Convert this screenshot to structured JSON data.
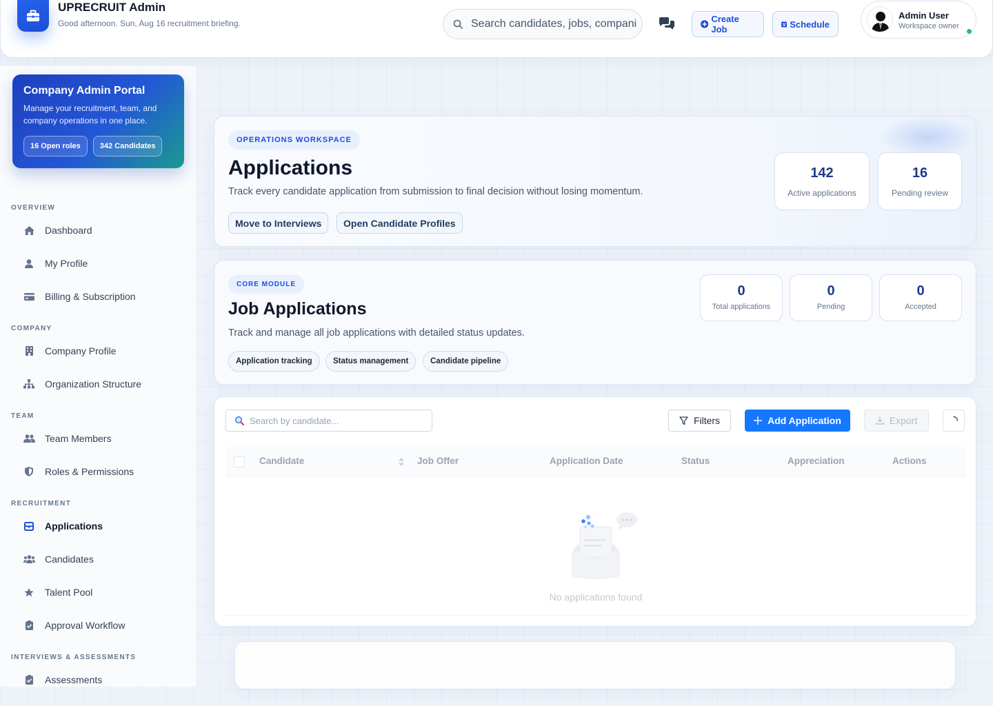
{
  "header": {
    "app_title": "UPRECRUIT Admin",
    "greeting": "Good afternoon. Sun, Aug 16 recruitment briefing.",
    "search_placeholder": "Search candidates, jobs, companies",
    "create_job_label": "Create Job",
    "schedule_label": "Schedule",
    "user_name": "Admin User",
    "user_role": "Workspace owner"
  },
  "sidebar": {
    "portal": {
      "title": "Company Admin Portal",
      "description": "Manage your recruitment, team, and company operations in one place.",
      "tags": [
        "16 Open roles",
        "342 Candidates"
      ]
    },
    "sections": [
      {
        "title": "OVERVIEW",
        "items": [
          {
            "label": "Dashboard",
            "icon": "home-icon"
          },
          {
            "label": "My Profile",
            "icon": "user-icon"
          },
          {
            "label": "Billing & Subscription",
            "icon": "credit-card-icon"
          }
        ]
      },
      {
        "title": "COMPANY",
        "items": [
          {
            "label": "Company Profile",
            "icon": "building-icon"
          },
          {
            "label": "Organization Structure",
            "icon": "org-chart-icon"
          }
        ]
      },
      {
        "title": "TEAM",
        "items": [
          {
            "label": "Team Members",
            "icon": "users-icon"
          },
          {
            "label": "Roles & Permissions",
            "icon": "shield-icon"
          }
        ]
      },
      {
        "title": "RECRUITMENT",
        "items": [
          {
            "label": "Applications",
            "icon": "inbox-icon",
            "active": true
          },
          {
            "label": "Candidates",
            "icon": "user-group-icon"
          },
          {
            "label": "Talent Pool",
            "icon": "star-icon"
          },
          {
            "label": "Approval Workflow",
            "icon": "clipboard-check-icon"
          }
        ]
      },
      {
        "title": "INTERVIEWS & ASSESSMENTS",
        "items": [
          {
            "label": "Assessments",
            "icon": "clipboard-check-icon"
          }
        ]
      }
    ]
  },
  "operations": {
    "eyebrow": "OPERATIONS WORKSPACE",
    "title": "Applications",
    "description": "Track every candidate application from submission to final decision without losing momentum.",
    "actions": [
      "Move to Interviews",
      "Open Candidate Profiles"
    ],
    "stats": [
      {
        "value": "142",
        "label": "Active applications"
      },
      {
        "value": "16",
        "label": "Pending review"
      }
    ]
  },
  "core_module": {
    "eyebrow": "CORE MODULE",
    "title": "Job Applications",
    "description": "Track and manage all job applications with detailed status updates.",
    "chips": [
      "Application tracking",
      "Status management",
      "Candidate pipeline"
    ],
    "stats": [
      {
        "value": "0",
        "label": "Total applications"
      },
      {
        "value": "0",
        "label": "Pending"
      },
      {
        "value": "0",
        "label": "Accepted"
      }
    ]
  },
  "table": {
    "search_placeholder": "Search by candidate...",
    "filters_label": "Filters",
    "add_label": "Add Application",
    "export_label": "Export",
    "columns": [
      "Candidate",
      "Job Offer",
      "Application Date",
      "Status",
      "Appreciation",
      "Actions"
    ],
    "empty_text": "No applications found"
  },
  "colors": {
    "accent": "#1677ff",
    "brand": "#2563eb",
    "online": "#22c55e"
  }
}
